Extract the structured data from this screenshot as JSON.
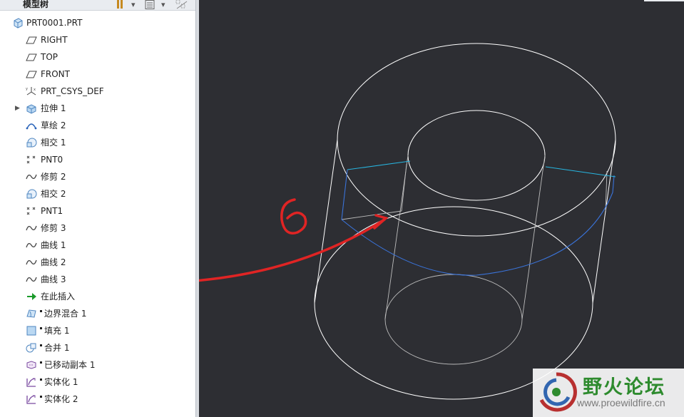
{
  "model_tree": {
    "title": "模型树",
    "header_icons": [
      "tree-filter-icon",
      "dropdown-arrow-icon",
      "list-settings-icon",
      "dropdown-arrow-icon",
      "show-hide-icon"
    ],
    "items": [
      {
        "label": "PRT0001.PRT",
        "icon": "part-icon",
        "indent": 0
      },
      {
        "label": "RIGHT",
        "icon": "datum-plane-icon",
        "indent": 1
      },
      {
        "label": "TOP",
        "icon": "datum-plane-icon",
        "indent": 1
      },
      {
        "label": "FRONT",
        "icon": "datum-plane-icon",
        "indent": 1
      },
      {
        "label": "PRT_CSYS_DEF",
        "icon": "coordinate-system-icon",
        "indent": 1
      },
      {
        "label": "拉伸 1",
        "icon": "extrude-icon",
        "indent": 1,
        "expandable": true
      },
      {
        "label": "草绘 2",
        "icon": "sketch-icon",
        "indent": 1
      },
      {
        "label": "相交 1",
        "icon": "intersect-icon",
        "indent": 1
      },
      {
        "label": "PNT0",
        "icon": "datum-point-icon",
        "indent": 1
      },
      {
        "label": "修剪 2",
        "icon": "curve-icon",
        "indent": 1
      },
      {
        "label": "相交 2",
        "icon": "intersect-icon",
        "indent": 1
      },
      {
        "label": "PNT1",
        "icon": "datum-point-icon",
        "indent": 1
      },
      {
        "label": "修剪 3",
        "icon": "curve-icon",
        "indent": 1
      },
      {
        "label": "曲线 1",
        "icon": "curve-icon",
        "indent": 1
      },
      {
        "label": "曲线 2",
        "icon": "curve-icon",
        "indent": 1
      },
      {
        "label": "曲线 3",
        "icon": "curve-icon",
        "indent": 1
      },
      {
        "label": "在此插入",
        "icon": "insert-here-arrow-icon",
        "indent": 1
      },
      {
        "label": "边界混合 1",
        "icon": "boundary-blend-icon",
        "indent": 1,
        "marker": true
      },
      {
        "label": "填充 1",
        "icon": "fill-icon",
        "indent": 1,
        "marker": true
      },
      {
        "label": "合并 1",
        "icon": "merge-icon",
        "indent": 1,
        "marker": true
      },
      {
        "label": "已移动副本 1",
        "icon": "moved-copy-icon",
        "indent": 1,
        "marker": true
      },
      {
        "label": "实体化 1",
        "icon": "solidify-icon",
        "indent": 1,
        "marker": true
      },
      {
        "label": "实体化 2",
        "icon": "solidify-icon",
        "indent": 1,
        "marker": true
      }
    ]
  },
  "annotation": {
    "number": "6",
    "color": "#e02424"
  },
  "viewport": {
    "background": "#2d2e33",
    "edge_color": "#ffffff",
    "highlight_color": "#3a73d9",
    "cyan_color": "#27b5e0"
  },
  "watermark": {
    "title": "野火论坛",
    "url": "www.proewildfire.cn"
  }
}
